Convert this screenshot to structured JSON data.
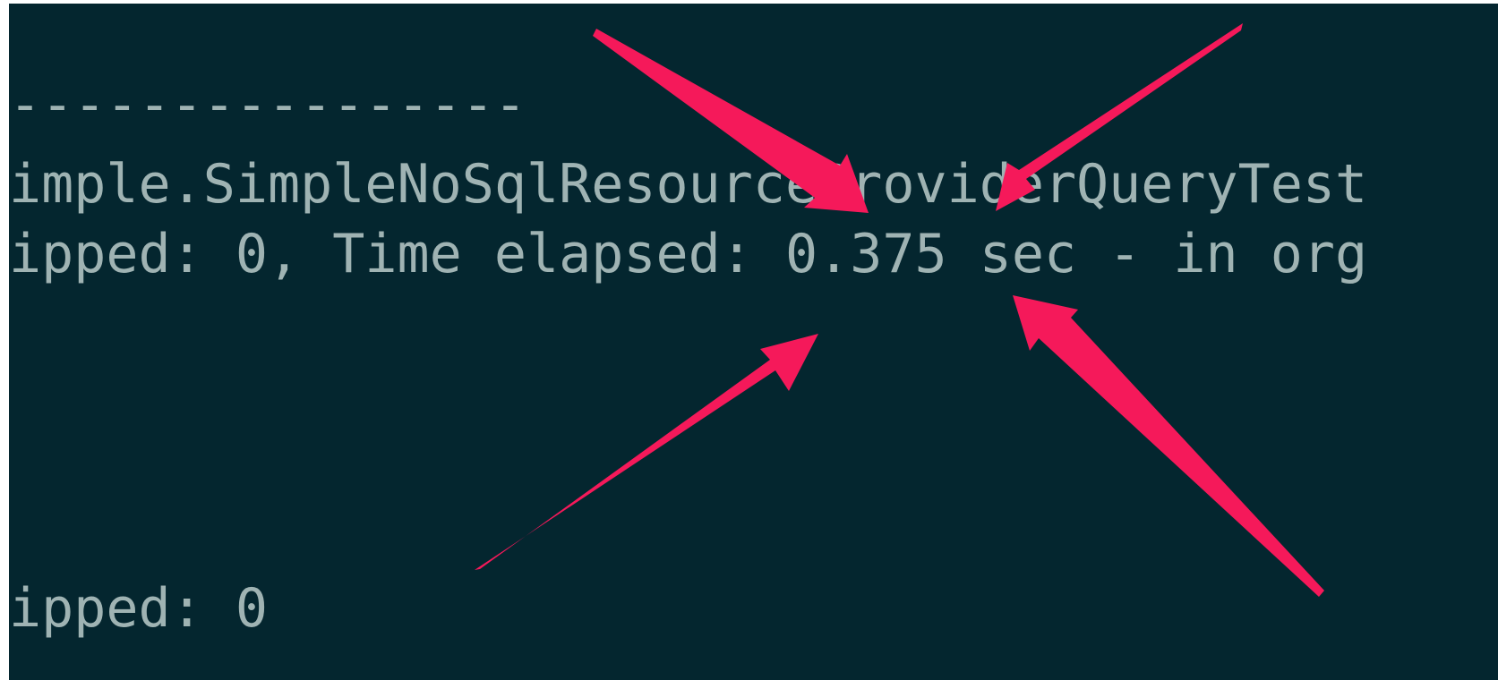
{
  "terminal": {
    "background_color": "#04262f",
    "text_color": "#9fb3b3",
    "lines": [
      "----------------",
      "imple.SimpleNoSqlResourceProviderQueryTest",
      "ipped: 0, Time elapsed: 0.375 sec - in org",
      "ipped: 0"
    ]
  },
  "annotation": {
    "arrow_color": "#f5195a",
    "arrow_count": 4
  }
}
